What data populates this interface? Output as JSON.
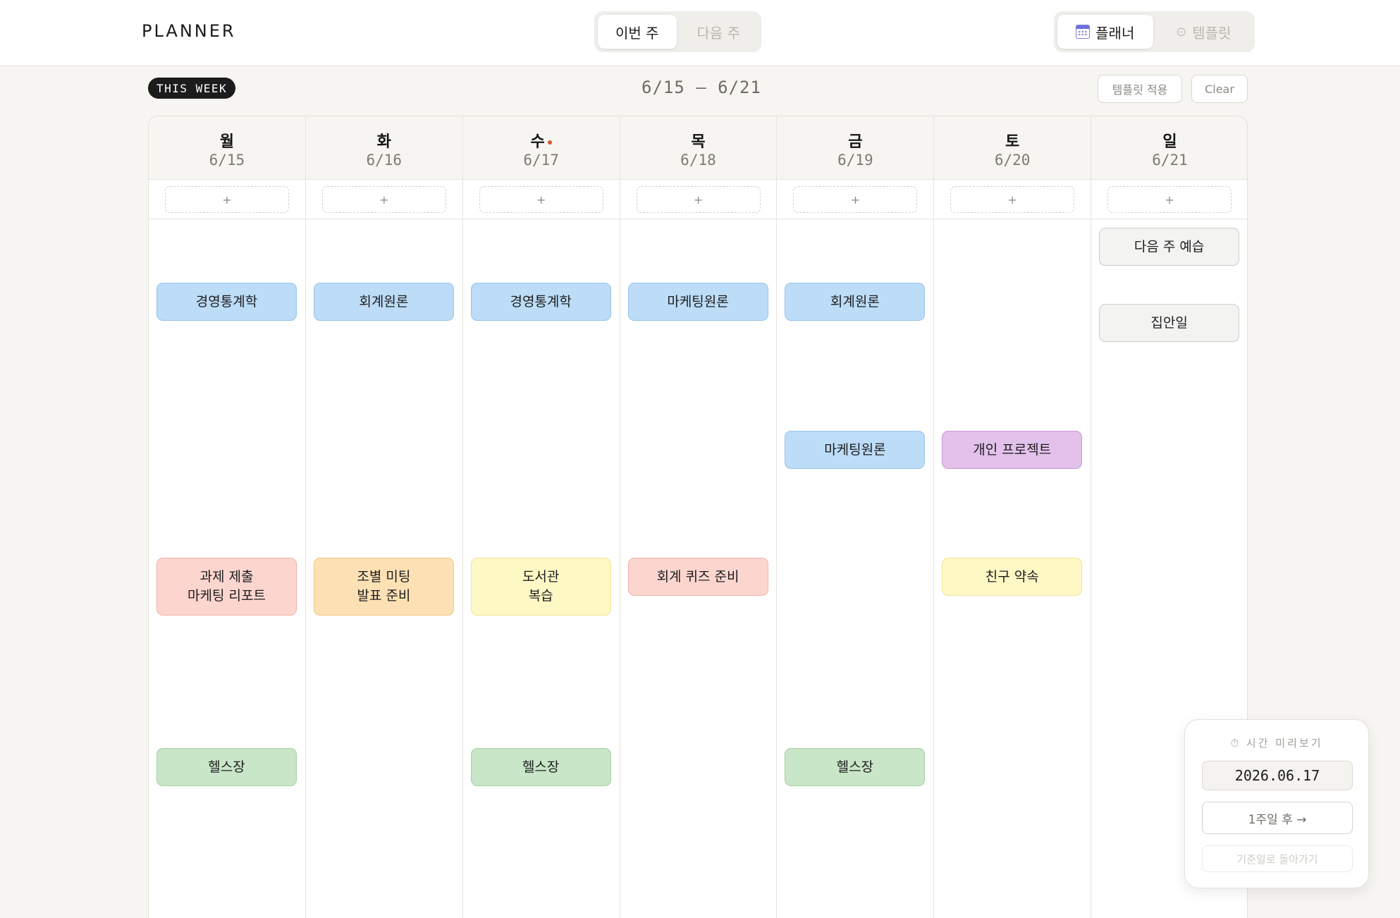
{
  "brand": "PLANNER",
  "week_toggle": {
    "this_week": "이번 주",
    "next_week": "다음 주"
  },
  "view_toggle": {
    "planner": "플래너",
    "template": "템플릿",
    "template_icon": "⊙"
  },
  "toolbar": {
    "badge": "THIS WEEK",
    "range": "6/15 — 6/21",
    "apply_template": "템플릿 적용",
    "clear": "Clear"
  },
  "add_label": "+",
  "days": [
    {
      "dow": "월",
      "date": "6/15",
      "today": false
    },
    {
      "dow": "화",
      "date": "6/16",
      "today": false
    },
    {
      "dow": "수",
      "date": "6/17",
      "today": true
    },
    {
      "dow": "목",
      "date": "6/18",
      "today": false
    },
    {
      "dow": "금",
      "date": "6/19",
      "today": false
    },
    {
      "dow": "토",
      "date": "6/20",
      "today": false
    },
    {
      "dow": "일",
      "date": "6/21",
      "today": false
    }
  ],
  "events": {
    "mon_1": "경영통계학",
    "mon_2_line1": "과제 제출",
    "mon_2_line2": "마케팅 리포트",
    "mon_3": "헬스장",
    "tue_1": "회계원론",
    "tue_2_line1": "조별 미팅",
    "tue_2_line2": "발표 준비",
    "wed_1": "경영통계학",
    "wed_2_line1": "도서관",
    "wed_2_line2": "복습",
    "wed_3": "헬스장",
    "thu_1": "마케팅원론",
    "thu_2": "회계 퀴즈 준비",
    "fri_1": "회계원론",
    "fri_2": "마케팅원론",
    "fri_3": "헬스장",
    "sat_1": "개인 프로젝트",
    "sat_2": "친구 약속",
    "sun_1": "다음 주 예습",
    "sun_2": "집안일"
  },
  "colors": {
    "blue": "#bcdcf7",
    "red": "#fdd5cf",
    "orange": "#fde1b5",
    "yellow": "#fef8c5",
    "green": "#c9e6c8",
    "purple": "#e2c1eb",
    "gray": "#f3f3f2",
    "today_dot": "#e0533a"
  },
  "preview": {
    "title": "⏱ 시간 미리보기",
    "date": "2026.06.17",
    "next": "1주일 후 →",
    "back": "기준일로 돌아가기"
  }
}
